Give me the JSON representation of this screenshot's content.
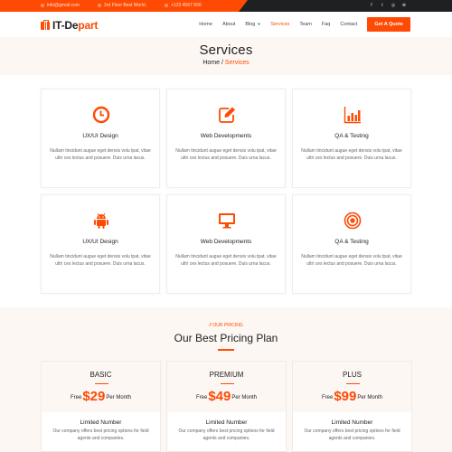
{
  "topbar": {
    "email": "info@gmail.com",
    "address": "3rd Floor Best World.",
    "phone": "+123 4567 890",
    "social": [
      {
        "icon": "facebook-icon",
        "glyph": "f"
      },
      {
        "icon": "twitter-icon",
        "glyph": "t"
      },
      {
        "icon": "instagram-icon",
        "glyph": "◎"
      },
      {
        "icon": "dribbble-icon",
        "glyph": "⊗"
      }
    ]
  },
  "header": {
    "logo_main": "IT-De",
    "logo_accent": "part",
    "nav": [
      {
        "label": "Home",
        "active": false
      },
      {
        "label": "About",
        "active": false
      },
      {
        "label": "Blog",
        "active": false,
        "dropdown": true
      },
      {
        "label": "Services",
        "active": true
      },
      {
        "label": "Team",
        "active": false
      },
      {
        "label": "Faq",
        "active": false
      },
      {
        "label": "Contact",
        "active": false
      }
    ],
    "cta": "Get A Quote"
  },
  "title_band": {
    "title": "Services",
    "breadcrumb_home": "Home",
    "breadcrumb_sep": " / ",
    "breadcrumb_current": "Services"
  },
  "services": [
    {
      "icon": "clock-icon",
      "title": "UX/UI Design",
      "desc": "Nullam tincidunt augue eget densis volu tpat, vitae ultri ces lectus and posuere. Duis urna lacus."
    },
    {
      "icon": "edit-icon",
      "title": "Web Developments",
      "desc": "Nullam tincidunt augue eget densis volu tpat, vitae ultri ces lectus and posuere. Duis urna lacus."
    },
    {
      "icon": "bar-chart-icon",
      "title": "QA & Testing",
      "desc": "Nullam tincidunt augue eget densis volu tpat, vitae ultri ces lectus and posuere. Duis urna lacus."
    },
    {
      "icon": "android-icon",
      "title": "UX/UI Design",
      "desc": "Nullam tincidunt augue eget densis volu tpat, vitae ultri ces lectus and posuere. Duis urna lacus."
    },
    {
      "icon": "monitor-icon",
      "title": "Web Developments",
      "desc": "Nullam tincidunt augue eget densis volu tpat, vitae ultri ces lectus and posuere. Duis urna lacus."
    },
    {
      "icon": "target-icon",
      "title": "QA & Testing",
      "desc": "Nullam tincidunt augue eget densis volu tpat, vitae ultri ces lectus and posuere. Duis urna lacus."
    }
  ],
  "pricing": {
    "subtitle": "// OUR PRICING",
    "title": "Our Best Pricing Plan",
    "plans": [
      {
        "name": "BASIC",
        "prefix": "Free",
        "price": "$29",
        "suffix": "Per Month",
        "feature": "Limited Number",
        "feature_desc": "Our company offers best pricing options for field agents and companies."
      },
      {
        "name": "PREMIUM",
        "prefix": "Free",
        "price": "$49",
        "suffix": "Per Month",
        "feature": "Limited Number",
        "feature_desc": "Our company offers best pricing options for field agents and companies."
      },
      {
        "name": "PLUS",
        "prefix": "Free",
        "price": "$99",
        "suffix": "Per Month",
        "feature": "Limited Number",
        "feature_desc": "Our company offers best pricing options for field agents and companies."
      }
    ]
  },
  "colors": {
    "accent": "#fe4a03",
    "dark": "#1f2022",
    "band": "#fdf7f4"
  }
}
